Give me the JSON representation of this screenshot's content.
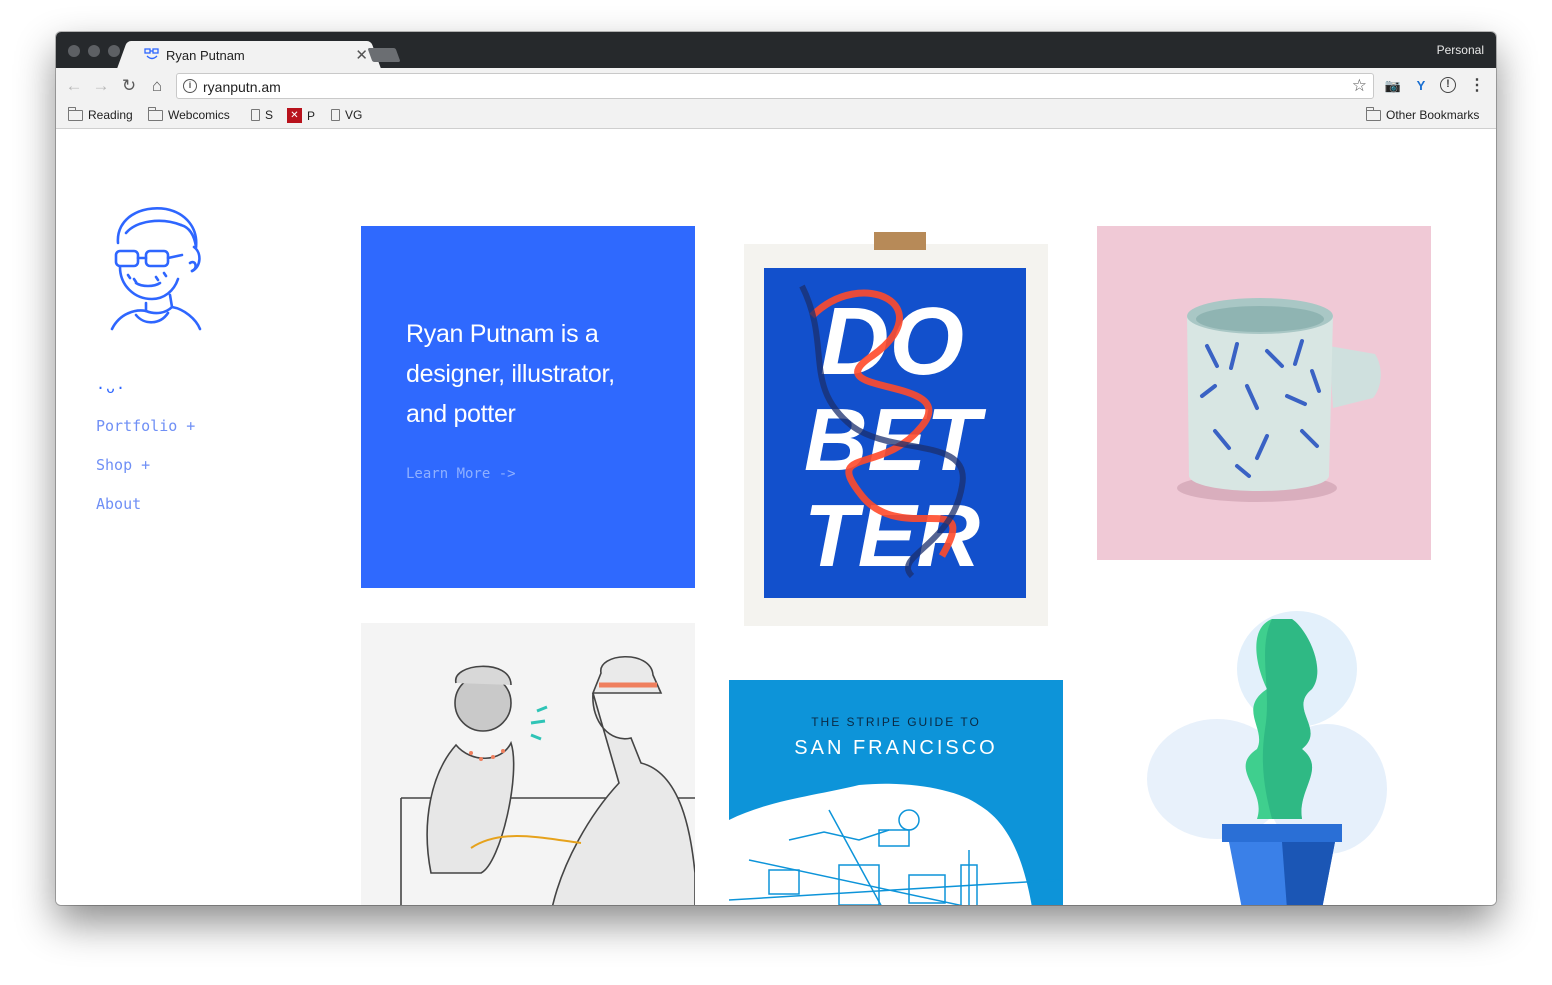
{
  "browser": {
    "tab_title": "Ryan Putnam",
    "profile": "Personal",
    "url": "ryanputn.am",
    "bookmarks": [
      "Reading",
      "Webcomics",
      "S",
      "P",
      "VG"
    ],
    "other_bookmarks": "Other Bookmarks"
  },
  "sidebar": {
    "smiley": "·ᴗ·",
    "nav": [
      "Portfolio +",
      "Shop +",
      "About"
    ]
  },
  "intro": {
    "headline": "Ryan Putnam is a designer, illustrator, and potter",
    "cta": "Learn More ->"
  },
  "poster": {
    "lines": [
      "DO",
      "BET",
      "TER"
    ]
  },
  "sf_card": {
    "kicker": "THE STRIPE GUIDE TO",
    "title": "SAN FRANCISCO"
  },
  "colors": {
    "brand_blue": "#2f69fe",
    "nav_blue": "#6f8ff5",
    "sf_blue": "#0d94d9",
    "mug_pink": "#f0c9d6"
  }
}
